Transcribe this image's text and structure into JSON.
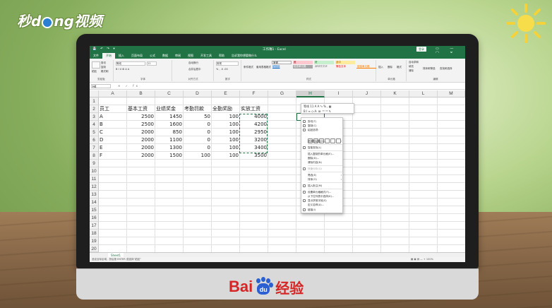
{
  "watermark": {
    "logo_left": "秒",
    "logo_mid": "d",
    "logo_ring": "",
    "logo_right": "ng视频"
  },
  "baidu": {
    "bai": "Bai",
    "du": "du",
    "jingyan": "经验"
  },
  "excel": {
    "title": "工作簿1 - Excel",
    "login": "登录",
    "quick_access": "💾 ↶ ↷ ▾",
    "window_buttons": "▭ — ▢ ✕",
    "menu": [
      "文件",
      "开始",
      "插入",
      "页面布局",
      "公式",
      "数据",
      "审阅",
      "视图",
      "开发工具",
      "帮助",
      "告诉我你想要做什么"
    ],
    "ribbon": {
      "paste": "粘贴",
      "cut": "剪切",
      "copy": "复制",
      "format_painter": "格式刷",
      "clipboard": "剪贴板",
      "font_name": "等线",
      "font_size": "11",
      "font_buttons": "B  I  U  ⊞  A  A",
      "font_group": "字体",
      "wrap": "自动换行",
      "merge": "合并后居中",
      "align_group": "对齐方式",
      "number_format": "常规",
      "number_buttons": "% , .0 .00",
      "number_group": "数字",
      "cond_format": "条件格式",
      "table_format": "套用表格格式",
      "cell_styles": [
        "常规",
        "差",
        "好",
        "适中",
        "超链接",
        "检查单元格",
        "解释性文本",
        "警告文本",
        "链接单元格"
      ],
      "styles_group": "样式",
      "insert": "插入",
      "delete": "删除",
      "format": "格式",
      "cells_group": "单元格",
      "autosum": "自动求和",
      "fill": "填充",
      "clear": "清除",
      "sort_filter": "排序和筛选",
      "find_select": "查找和选择",
      "edit_group": "编辑"
    },
    "name_box": "H4",
    "fx": "✕ ✓ fx",
    "columns": [
      "A",
      "B",
      "C",
      "D",
      "E",
      "F",
      "G",
      "H",
      "I",
      "J",
      "K",
      "L",
      "M"
    ],
    "rows": [
      "1",
      "2",
      "3",
      "4",
      "5",
      "6",
      "7",
      "8",
      "9",
      "10",
      "11",
      "12",
      "13",
      "14",
      "15",
      "16",
      "17",
      "18",
      "19",
      "20"
    ],
    "headers": [
      "员工",
      "基本工资",
      "业绩奖金",
      "考勤罚款",
      "全勤奖励",
      "实放工资"
    ],
    "data": [
      [
        "A",
        "2500",
        "1450",
        "50",
        "100",
        "4000"
      ],
      [
        "B",
        "2500",
        "1600",
        "0",
        "100",
        "4200"
      ],
      [
        "C",
        "2000",
        "850",
        "0",
        "100",
        "2950"
      ],
      [
        "D",
        "2000",
        "1100",
        "0",
        "100",
        "3200"
      ],
      [
        "E",
        "2000",
        "1300",
        "0",
        "100",
        "3400"
      ],
      [
        "F",
        "2000",
        "1500",
        "100",
        "100",
        "3500"
      ]
    ],
    "sheet_tab": "Sheet1",
    "status_left": "选定目标区域，然后按 ENTER 或选择“粘贴”",
    "status_right": "▦ ▣ ▤  —  +  100%",
    "mini_toolbar": {
      "row1": "等线  11  A A  ⁶₀ % ,  ▦",
      "row2": "B I ≡ ◇·A· ⊞· ⁰⁰ ⁰⁰ ✎"
    },
    "context_menu": {
      "items_top": [
        "剪切(T)",
        "复制(C)",
        "粘贴选项:"
      ],
      "items_mid": [
        "选择性粘贴(S)...",
        "智能查找(L)",
        "插入复制的单元格(E)...",
        "删除(D)...",
        "清除内容(N)"
      ],
      "items_disabled": [
        "快速分析(Q)"
      ],
      "items_sub": [
        "筛选(E)",
        "排序(O)"
      ],
      "items_bottom": [
        "插入批注(M)",
        "设置单元格格式(F)...",
        "从下拉列表中选择(K)...",
        "显示拼音字段(S)",
        "定义名称(A)...",
        "链接(I)"
      ]
    }
  }
}
